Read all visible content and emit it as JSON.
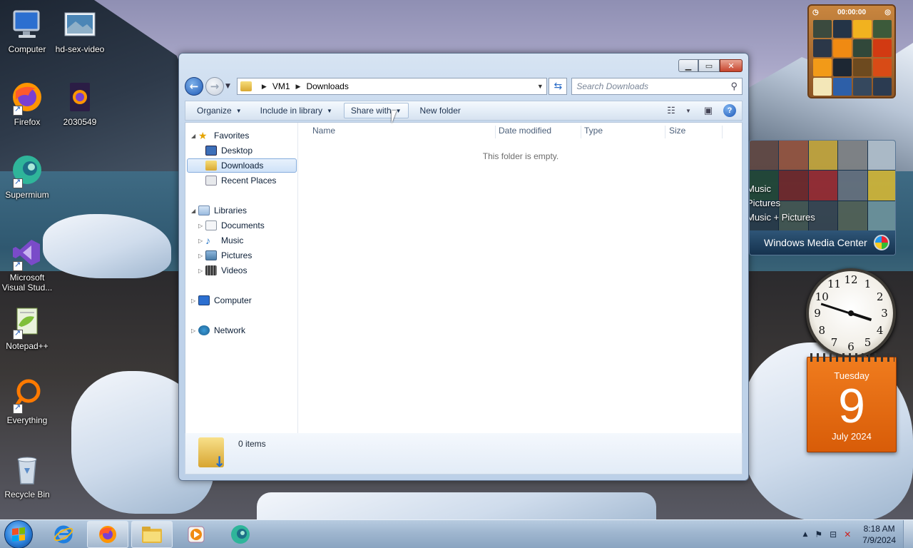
{
  "desktop": {
    "icons": [
      {
        "label": "Computer",
        "icon": "computer-icon"
      },
      {
        "label": "hd-sex-video",
        "icon": "image-file-icon"
      },
      {
        "label": "Firefox",
        "icon": "firefox-icon"
      },
      {
        "label": "2030549",
        "icon": "firefox-file-icon"
      },
      {
        "label": "Supermium",
        "icon": "supermium-icon"
      },
      {
        "label": "Microsoft Visual Stud...",
        "icon": "visual-studio-icon"
      },
      {
        "label": "Notepad++",
        "icon": "notepadpp-icon"
      },
      {
        "label": "Everything",
        "icon": "everything-icon"
      },
      {
        "label": "Recycle Bin",
        "icon": "recycle-bin-icon"
      }
    ]
  },
  "explorer": {
    "address": {
      "root": "VM1",
      "current": "Downloads"
    },
    "search_placeholder": "Search Downloads",
    "toolbar": {
      "organize": "Organize",
      "include_in_library": "Include in library",
      "share_with": "Share with",
      "new_folder": "New folder"
    },
    "nav": {
      "favorites": "Favorites",
      "desktop": "Desktop",
      "downloads": "Downloads",
      "recent_places": "Recent Places",
      "libraries": "Libraries",
      "documents": "Documents",
      "music": "Music",
      "pictures": "Pictures",
      "videos": "Videos",
      "computer": "Computer",
      "network": "Network"
    },
    "columns": {
      "name": "Name",
      "date_modified": "Date modified",
      "type": "Type",
      "size": "Size"
    },
    "empty_message": "This folder is empty.",
    "details": {
      "item_count": "0 items"
    }
  },
  "gadgets": {
    "puzzle_timer": "00:00:00",
    "media_center": {
      "menu": [
        "Music",
        "Pictures",
        "Music + Pictures"
      ],
      "brand": "Windows Media Center"
    },
    "clock_numbers": [
      "12",
      "1",
      "2",
      "3",
      "4",
      "5",
      "6",
      "7",
      "8",
      "9",
      "10",
      "11"
    ],
    "calendar": {
      "weekday": "Tuesday",
      "day": "9",
      "month_year": "July 2024"
    }
  },
  "taskbar": {
    "time": "8:18 AM",
    "date": "7/9/2024"
  },
  "colors": {
    "accent": "#2a7fd9",
    "calendar": "#e8680f",
    "selection": "#cfe2f8"
  }
}
